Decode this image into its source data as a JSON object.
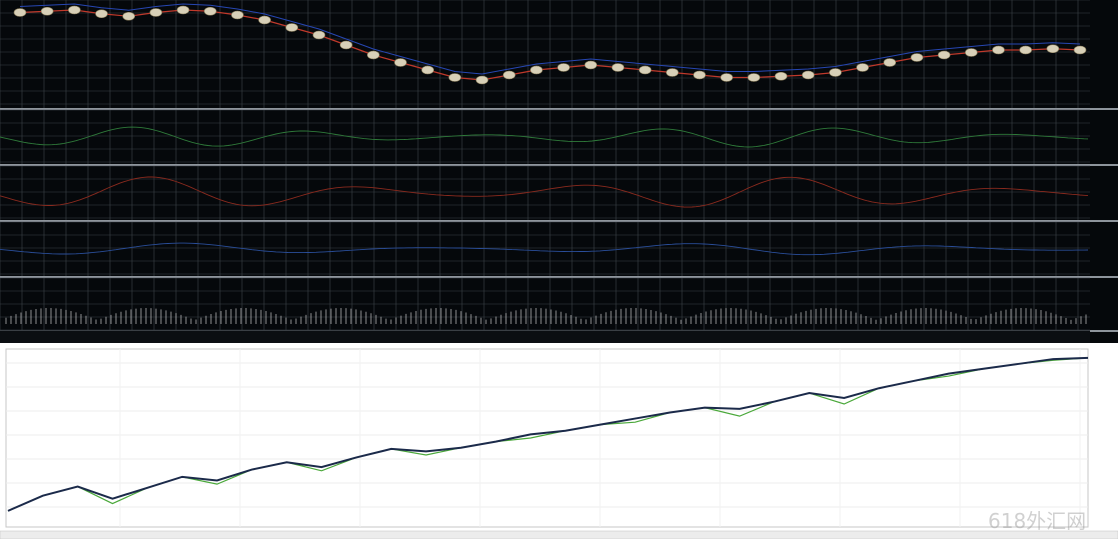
{
  "watermark": "618外汇网",
  "colors": {
    "terminal_bg": "#05080b",
    "grid": "#3d434a",
    "price_red": "#c0392b",
    "price_blue": "#2747b3",
    "balance": "#1b2a4a",
    "equity": "#4aa83a",
    "indicator_green": "#2f7a3a",
    "indicator_red": "#8a2a1e",
    "indicator_blue": "#2a4e9a",
    "volume": "#c9c9c9"
  },
  "chart_data": [
    {
      "type": "line",
      "series": [
        {
          "values": [
            18,
            17,
            16,
            19,
            21,
            18,
            16,
            17,
            20,
            24,
            30,
            36,
            44,
            52,
            58,
            64,
            70,
            72,
            68,
            64,
            62,
            60,
            62,
            64,
            66,
            68,
            70,
            70,
            69,
            68,
            66,
            62,
            58,
            54,
            52,
            50,
            48,
            48,
            47,
            48
          ]
        }
      ]
    },
    {
      "type": "area",
      "series": [
        {
          "values": [
            120,
            145,
            160,
            140,
            158,
            176,
            170,
            188,
            200,
            192,
            208,
            222,
            218,
            224,
            234,
            246,
            252,
            262,
            272,
            282,
            290,
            288,
            300,
            314,
            306,
            322,
            334,
            346,
            354,
            362,
            370,
            372
          ]
        },
        {
          "values": [
            120,
            145,
            160,
            132,
            158,
            176,
            164,
            188,
            200,
            186,
            208,
            222,
            212,
            224,
            234,
            240,
            252,
            262,
            266,
            282,
            290,
            276,
            300,
            314,
            296,
            322,
            334,
            342,
            354,
            362,
            368,
            372
          ]
        }
      ]
    }
  ]
}
